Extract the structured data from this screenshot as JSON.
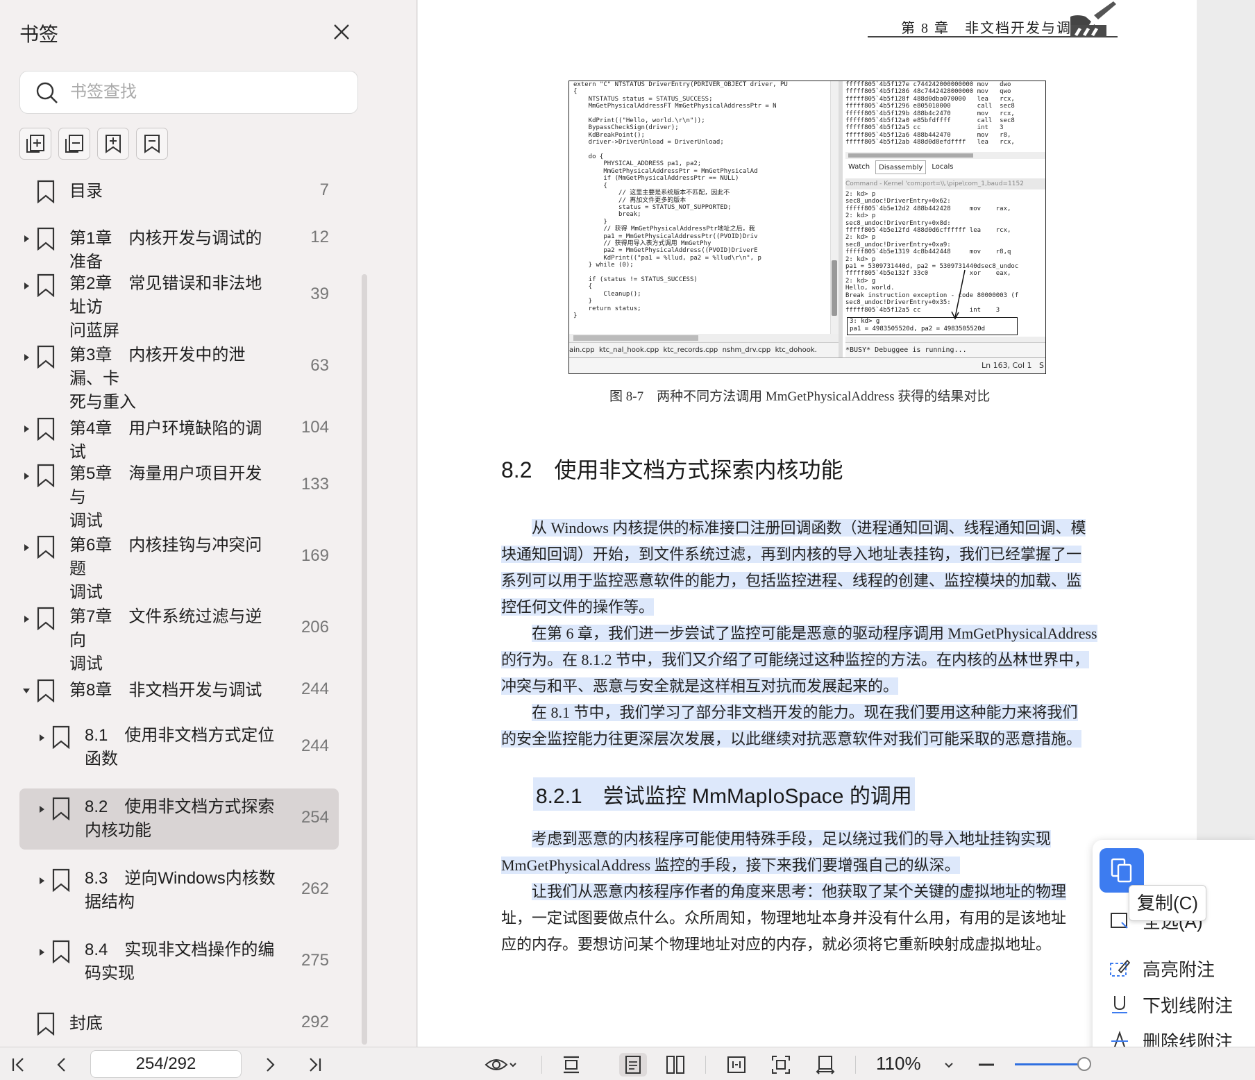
{
  "sidebar": {
    "title": "书签",
    "search_placeholder": "书签查找",
    "bookmarks": [
      {
        "line1": "目录",
        "line2": "",
        "page": "7",
        "arrow": "none",
        "level": 0
      },
      {
        "line1": "第1章　内核开发与调试的准备",
        "line2": "",
        "page": "12",
        "arrow": "right",
        "level": 0
      },
      {
        "line1": "第2章　常见错误和非法地址访",
        "line2": "问蓝屏",
        "page": "39",
        "arrow": "right",
        "level": 0
      },
      {
        "line1": "第3章　内核开发中的泄漏、卡",
        "line2": "死与重入",
        "page": "63",
        "arrow": "right",
        "level": 0
      },
      {
        "line1": "第4章　用户环境缺陷的调试",
        "line2": "",
        "page": "104",
        "arrow": "right",
        "level": 0
      },
      {
        "line1": "第5章　海量用户项目开发与",
        "line2": "调试",
        "page": "133",
        "arrow": "right",
        "level": 0
      },
      {
        "line1": "第6章　内核挂钩与冲突问题",
        "line2": "调试",
        "page": "169",
        "arrow": "right",
        "level": 0
      },
      {
        "line1": "第7章　文件系统过滤与逆向",
        "line2": "调试",
        "page": "206",
        "arrow": "right",
        "level": 0
      },
      {
        "line1": "第8章　非文档开发与调试",
        "line2": "",
        "page": "244",
        "arrow": "down",
        "level": 0
      },
      {
        "line1": "8.1　使用非文档方式定位",
        "line2": "函数",
        "page": "244",
        "arrow": "right",
        "level": 1
      },
      {
        "line1": "8.2　使用非文档方式探索",
        "line2": "内核功能",
        "page": "254",
        "arrow": "right",
        "level": 1,
        "selected": true
      },
      {
        "line1": "8.3　逆向Windows内核数",
        "line2": "据结构",
        "page": "262",
        "arrow": "right",
        "level": 1
      },
      {
        "line1": "8.4　实现非文档操作的编",
        "line2": "码实现",
        "page": "275",
        "arrow": "right",
        "level": 1
      },
      {
        "line1": "封底",
        "line2": "",
        "page": "292",
        "arrow": "none",
        "level": 0
      }
    ]
  },
  "doc": {
    "running_head": "第 8 章　非文档开发与调试",
    "figure": {
      "code_lines": [
        "extern \"C\" NTSTATUS DriverEntry(PDRIVER_OBJECT driver, PU",
        "{",
        "    NTSTATUS status = STATUS_SUCCESS;",
        "    MmGetPhysicalAddressFT MmGetPhysicalAddressPtr = N",
        "",
        "    KdPrint((\"Hello, world.\\r\\n\"));",
        "    BypassCheckSign(driver);",
        "    KdBreakPoint();",
        "    driver->DriverUnload = DriverUnload;",
        "",
        "    do {",
        "        PHYSICAL_ADDRESS pa1, pa2;",
        "        MmGetPhysicalAddressPtr = MmGetPhysicalAd",
        "        if (MmGetPhysicalAddressPtr == NULL)",
        "        {",
        "            // 这里主要是系统版本不匹配，因此不",
        "            // 再加文件更多的版本",
        "            status = STATUS_NOT_SUPPORTED;",
        "            break;",
        "        }",
        "        // 获得 MmGetPhysicalAddressPtr地址之后，我",
        "        pa1 = MmGetPhysicalAddressPtr((PVOID)Driv",
        "        // 获得用导入表方式调用 MmGetPhy",
        "        pa2 = MmGetPhysicalAddress((PVOID)DriverE",
        "        KdPrint((\"pa1 = %llud, pa2 = %llud\\r\\n\", p",
        "    } while (0);",
        "",
        "    if (status != STATUS_SUCCESS)",
        "    {",
        "        Cleanup();",
        "    }",
        "    return status;",
        "}"
      ],
      "disasm_lines": [
        "fffff805`4b5f127e c744242000000000 mov   dwo",
        "fffff805`4b5f1286 48c7442428000000 mov   qwo",
        "fffff805`4b5f128f 488d0dba070000   lea   rcx,",
        "fffff805`4b5f1296 e805010000       call  sec8",
        "fffff805`4b5f129b 488b4c2470       mov   rcx,",
        "fffff805`4b5f12a0 e85bfdffff       call  sec8",
        "fffff805`4b5f12a5 cc               int   3",
        "fffff805`4b5f12a6 488b442470       mov   r8,",
        "fffff805`4b5f12ab 488d0d8efdffff   lea   rcx,"
      ],
      "debugger_tabs": [
        "Watch",
        "Disassembly",
        "Locals"
      ],
      "command_title": "Command - Kernel 'com:port=\\\\.\\pipe\\com_1,baud=1152",
      "cmd_lines": [
        "2: kd> p",
        "sec8_undoc!DriverEntry+0x62:",
        "fffff805`4b5e12d2 488b442428     mov    rax,",
        "2: kd> p",
        "sec8_undoc!DriverEntry+0x8d:",
        "fffff805`4b5e12fd 488d0d6cffffff lea    rcx,",
        "2: kd> p",
        "sec8_undoc!DriverEntry+0xa9:",
        "fffff805`4b5e1319 4c8b442448     mov    r8,q",
        "2: kd> p",
        "pa1 = 5309731440d, pa2 = 5309731440dsec8_undoc",
        "fffff805`4b5e132f 33c0           xor    eax,",
        "2: kd> g",
        "Hello, world.",
        "Break instruction exception - code 80000003 (f",
        "sec8_undoc!DriverEntry+0x35:",
        "fffff805`4b5f12a5 cc             int    3"
      ],
      "cmd_boxed": [
        "3: kd> g",
        "pa1 = 4983505520d, pa2 = 4983505520d"
      ],
      "file_tabs": "ain.cpp  ktc_nal_hook.cpp  ktc_records.cpp  nshm_drv.cpp  ktc_dohook.",
      "busy": "*BUSY* Debuggee is running...",
      "status": "Ln 163, Col 1   S",
      "caption": "图 8-7　两种不同方法调用 MmGetPhysicalAddress 获得的结果对比"
    },
    "h2": "8.2　使用非文档方式探索内核功能",
    "p1": [
      "从 Windows 内核提供的标准接口注册回调函数（进程通知回调、线程通知回调、模",
      "块通知回调）开始，到文件系统过滤，再到内核的导入地址表挂钩，我们已经掌握了一",
      "系列可以用于监控恶意软件的能力，包括监控进程、线程的创建、监控模块的加载、监",
      "控任何文件的操作等。"
    ],
    "p2": [
      "在第 6 章，我们进一步尝试了监控可能是恶意的驱动程序调用 MmGetPhysicalAddress",
      "的行为。在 8.1.2 节中，我们又介绍了可能绕过这种监控的方法。在内核的丛林世界中，",
      "冲突与和平、恶意与安全就是这样相互对抗而发展起来的。"
    ],
    "p3": [
      "在 8.1 节中，我们学习了部分非文档开发的能力。现在我们要用这种能力来将我们",
      "的安全监控能力往更深层次发展，以此继续对抗恶意软件对我们可能采取的恶意措施。"
    ],
    "h3": "8.2.1　尝试监控 MmMapIoSpace 的调用",
    "p4": [
      "考虑到恶意的内核程序可能使用特殊手段，足以绕过我们的导入地址挂钩实现",
      "MmGetPhysicalAddress 监控的手段，接下来我们要增强自己的纵深。"
    ],
    "p5": [
      "让我们从恶意内核程序作者的角度来思考：他获取了某个关键的虚拟地址的物理",
      "址，一定试图要做点什么。众所周知，物理地址本身并没有什么用，有用的是该地址",
      "应的内存。要想访问某个物理地址对应的内存，就必须将它重新映射成虚拟地址。"
    ]
  },
  "context_menu": {
    "copy_tooltip": "复制(C)",
    "select_all": "全选(A)",
    "highlight": "高亮附注",
    "underline": "下划线附注",
    "strikethrough": "删除线附注"
  },
  "bottombar": {
    "page_indicator": "254/292",
    "zoom": "110%"
  }
}
